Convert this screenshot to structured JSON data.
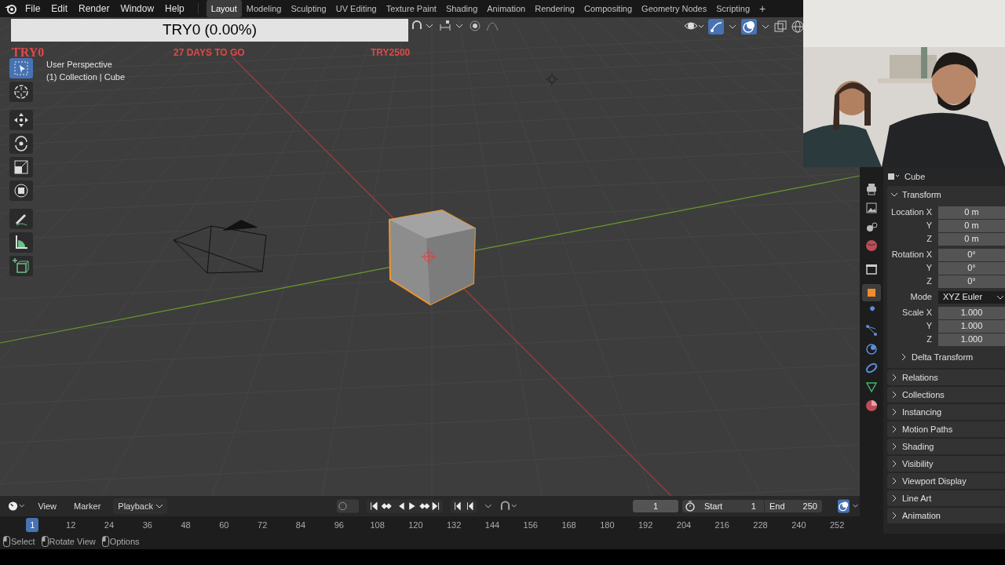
{
  "menu": [
    "File",
    "Edit",
    "Render",
    "Window",
    "Help"
  ],
  "workspaces": [
    {
      "label": "Layout",
      "selected": true
    },
    {
      "label": "Modeling",
      "selected": false
    },
    {
      "label": "Sculpting",
      "selected": false
    },
    {
      "label": "UV Editing",
      "selected": false
    },
    {
      "label": "Texture Paint",
      "selected": false
    },
    {
      "label": "Shading",
      "selected": false
    },
    {
      "label": "Animation",
      "selected": false
    },
    {
      "label": "Rendering",
      "selected": false
    },
    {
      "label": "Compositing",
      "selected": false
    },
    {
      "label": "Geometry Nodes",
      "selected": false
    },
    {
      "label": "Scripting",
      "selected": false
    }
  ],
  "add_workspace_button": "+",
  "stream_overlay": {
    "goal_bar": "TRY0 (0.00%)",
    "goal_start": "TRY0",
    "countdown": "27 DAYS TO GO",
    "goal_end": "TRY2500"
  },
  "viewport": {
    "info": [
      "User Perspective",
      "(1) Collection | Cube"
    ],
    "tools": [
      {
        "kind": "select",
        "selected": true
      },
      {
        "kind": "cursor",
        "selected": false
      },
      {
        "kind": "move",
        "selected": false
      },
      {
        "kind": "rotate",
        "selected": false
      },
      {
        "kind": "scale",
        "selected": false
      },
      {
        "kind": "transform",
        "selected": false
      },
      {
        "kind": "annotate",
        "selected": false
      },
      {
        "kind": "measure",
        "selected": false
      },
      {
        "kind": "add_cube",
        "selected": false
      }
    ]
  },
  "properties": {
    "object_name": "Cube",
    "tabs": [
      {
        "kind": "render",
        "selected": false
      },
      {
        "kind": "output",
        "selected": false
      },
      {
        "kind": "scene",
        "selected": false
      },
      {
        "kind": "world",
        "selected": false
      },
      {
        "kind": "collection",
        "selected": false
      },
      {
        "kind": "object",
        "selected": true
      },
      {
        "kind": "modifier",
        "selected": false
      },
      {
        "kind": "particles",
        "selected": false
      },
      {
        "kind": "physics",
        "selected": false
      },
      {
        "kind": "constraints",
        "selected": false
      },
      {
        "kind": "data",
        "selected": false
      },
      {
        "kind": "material",
        "selected": false
      }
    ],
    "transform": {
      "title": "Transform",
      "expanded": true,
      "rows": [
        {
          "kind": "number",
          "label": "Location X",
          "value": "0 m"
        },
        {
          "kind": "number",
          "label": "Y",
          "value": "0 m"
        },
        {
          "kind": "number",
          "label": "Z",
          "value": "0 m"
        },
        {
          "kind": "number",
          "label": "Rotation X",
          "value": "0°"
        },
        {
          "kind": "number",
          "label": "Y",
          "value": "0°"
        },
        {
          "kind": "number",
          "label": "Z",
          "value": "0°"
        },
        {
          "kind": "dropdown",
          "label": "Mode",
          "value": "XYZ Euler"
        },
        {
          "kind": "number",
          "label": "Scale X",
          "value": "1.000"
        },
        {
          "kind": "number",
          "label": "Y",
          "value": "1.000"
        },
        {
          "kind": "number",
          "label": "Z",
          "value": "1.000"
        }
      ],
      "subsection": "Delta Transform"
    },
    "sections": [
      {
        "title": "Relations",
        "expanded": false
      },
      {
        "title": "Collections",
        "expanded": false
      },
      {
        "title": "Instancing",
        "expanded": false
      },
      {
        "title": "Motion Paths",
        "expanded": false
      },
      {
        "title": "Shading",
        "expanded": false
      },
      {
        "title": "Visibility",
        "expanded": false
      },
      {
        "title": "Viewport Display",
        "expanded": false
      },
      {
        "title": "Line Art",
        "expanded": false
      },
      {
        "title": "Animation",
        "expanded": false
      }
    ]
  },
  "timeline": {
    "menus": [
      {
        "kind": "menu",
        "label": "View"
      },
      {
        "kind": "menu",
        "label": "Marker"
      },
      {
        "kind": "dropdown",
        "label": "Playback"
      }
    ],
    "current_frame": "1",
    "start_label": "Start",
    "start": "1",
    "end_label": "End",
    "end": "250",
    "ruler": [
      {
        "label": "1",
        "selected": true
      },
      {
        "label": "12",
        "selected": false
      },
      {
        "label": "24",
        "selected": false
      },
      {
        "label": "36",
        "selected": false
      },
      {
        "label": "48",
        "selected": false
      },
      {
        "label": "60",
        "selected": false
      },
      {
        "label": "72",
        "selected": false
      },
      {
        "label": "84",
        "selected": false
      },
      {
        "label": "96",
        "selected": false
      },
      {
        "label": "108",
        "selected": false
      },
      {
        "label": "120",
        "selected": false
      },
      {
        "label": "132",
        "selected": false
      },
      {
        "label": "144",
        "selected": false
      },
      {
        "label": "156",
        "selected": false
      },
      {
        "label": "168",
        "selected": false
      },
      {
        "label": "180",
        "selected": false
      },
      {
        "label": "192",
        "selected": false
      },
      {
        "label": "204",
        "selected": false
      },
      {
        "label": "216",
        "selected": false
      },
      {
        "label": "228",
        "selected": false
      },
      {
        "label": "240",
        "selected": false
      },
      {
        "label": "252",
        "selected": false
      }
    ]
  },
  "status_bar": [
    "Select",
    "Rotate View",
    "Options"
  ]
}
